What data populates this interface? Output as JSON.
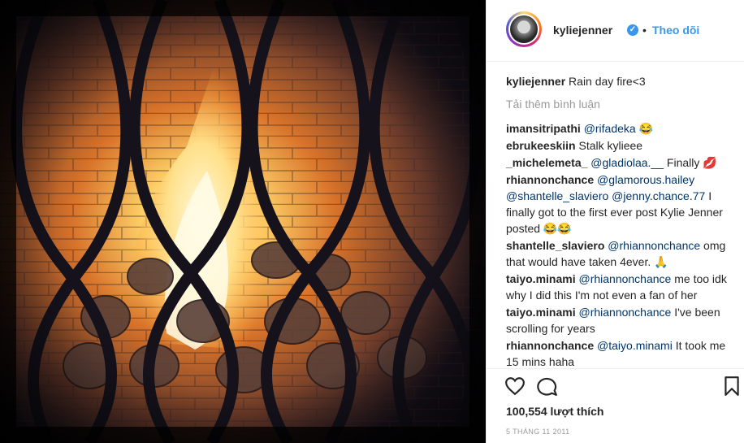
{
  "post": {
    "username": "kyliejenner",
    "verified_icon": "verified-badge-icon",
    "separator": "•",
    "follow_label": "Theo dõi",
    "caption": "Rain day fire<3",
    "load_more": "Tải thêm bình luận",
    "likes": "100,554 lượt thích",
    "date": "5 THÁNG 11 2011",
    "icons": [
      "heart-icon",
      "comment-icon",
      "bookmark-icon"
    ],
    "accent_color": "#3897f0"
  },
  "comments": [
    {
      "user": "imansitripathi",
      "mention": "@rifadeka",
      "text": " 😂"
    },
    {
      "user": "ebrukeeskiin",
      "mention": "",
      "text": "Stalk kylieee"
    },
    {
      "user": "_michelemeta_",
      "mention": "@gladiolaa.__",
      "text": " Finally 💋"
    },
    {
      "user": "rhiannonchance",
      "mention": "@glamorous.hailey @shantelle_slaviero @jenny.chance.77",
      "text": " I finally got to the first ever post Kylie Jenner posted 😂😂"
    },
    {
      "user": "shantelle_slaviero",
      "mention": "@rhiannonchance",
      "text": " omg that would have taken 4ever. 🙏"
    },
    {
      "user": "taiyo.minami",
      "mention": "@rhiannonchance",
      "text": " me too idk why I did this I'm not even a fan of her"
    },
    {
      "user": "taiyo.minami",
      "mention": "@rhiannonchance",
      "text": " I've been scrolling for years"
    },
    {
      "user": "rhiannonchance",
      "mention": "@taiyo.minami",
      "text": " It took me 15 mins haha"
    }
  ]
}
